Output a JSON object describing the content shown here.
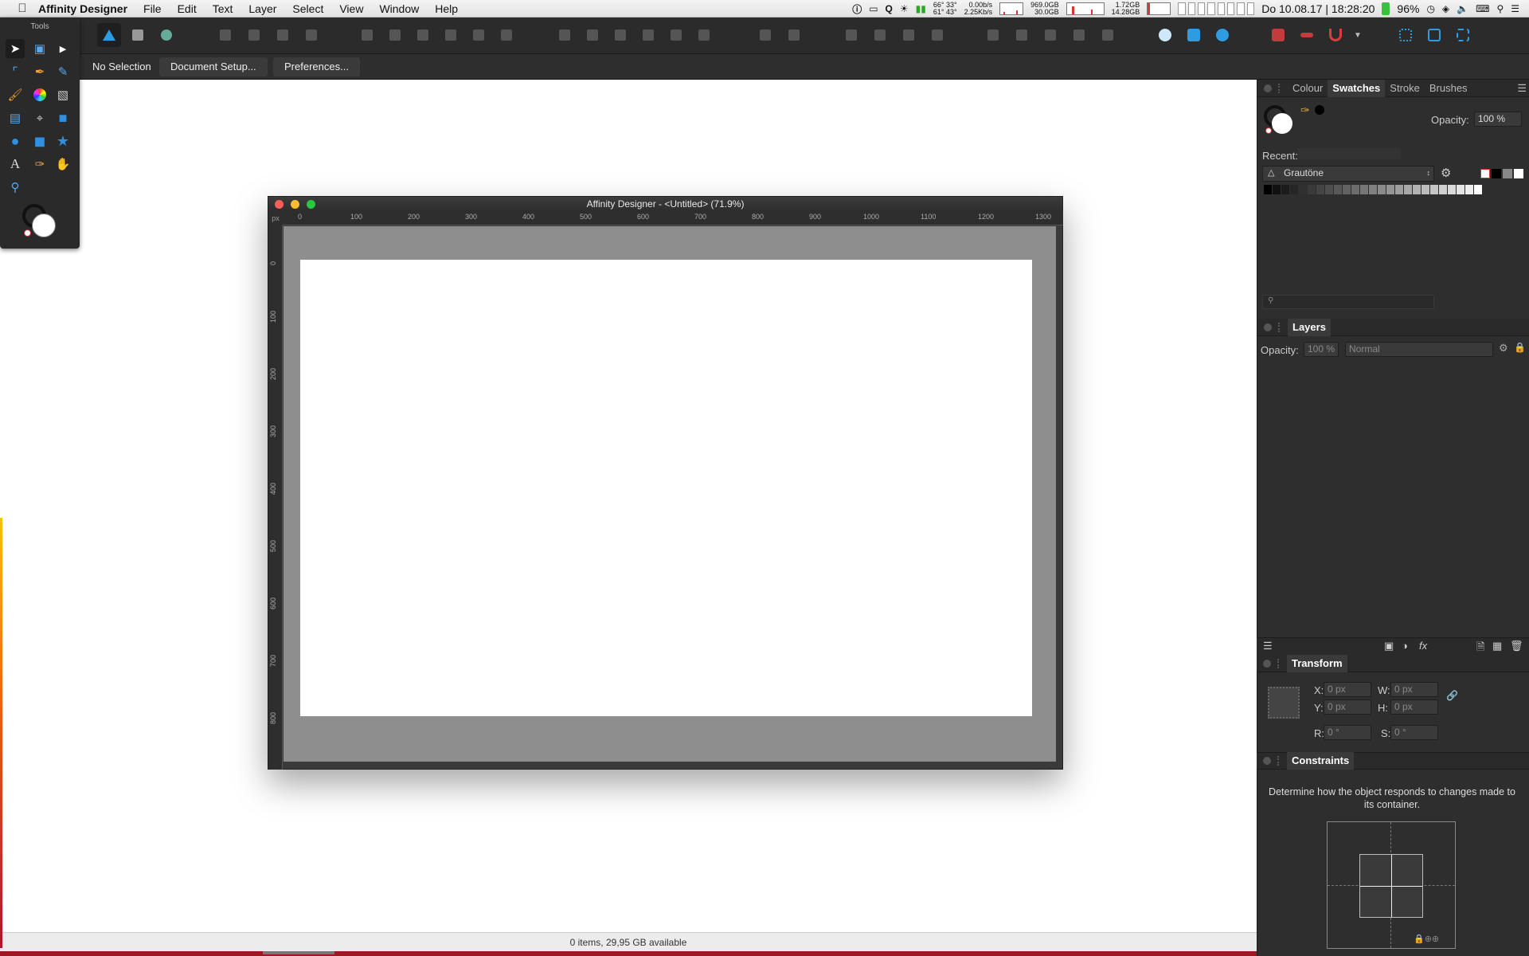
{
  "menubar": {
    "app_name": "Affinity Designer",
    "menus": [
      "File",
      "Edit",
      "Text",
      "Layer",
      "Select",
      "View",
      "Window",
      "Help"
    ],
    "status": {
      "temps": [
        "66°  33°",
        "61°  43°"
      ],
      "net": [
        "0.00b/s",
        "2.25Kb/s"
      ],
      "disk": [
        "969.0GB",
        "30.0GB"
      ],
      "mem": [
        "1.72GB",
        "14.28GB"
      ],
      "datetime": "Do 10.08.17 | 18:28:20",
      "battery": "96%"
    }
  },
  "context_toolbar": {
    "selection": "No Selection",
    "document_setup": "Document Setup...",
    "preferences": "Preferences..."
  },
  "tools_panel": {
    "title": "Tools"
  },
  "canvas_window": {
    "title": "Affinity Designer - <Untitled> (71.9%)",
    "ruler_unit": "px",
    "h_ticks": [
      "0",
      "100",
      "200",
      "300",
      "400",
      "500",
      "600",
      "700",
      "800",
      "900",
      "1000",
      "1100",
      "1200",
      "1300"
    ],
    "v_ticks": [
      "0",
      "100",
      "200",
      "300",
      "400",
      "500",
      "600",
      "700",
      "800"
    ]
  },
  "swatches_panel": {
    "tabs": [
      "Colour",
      "Swatches",
      "Stroke",
      "Brushes"
    ],
    "active_tab": "Swatches",
    "opacity_label": "Opacity:",
    "opacity_value": "100 %",
    "recent_label": "Recent:",
    "palette_name": "Grautöne",
    "grays": [
      "#000000",
      "#111111",
      "#1c1c1c",
      "#262626",
      "#303030",
      "#3a3a3a",
      "#444444",
      "#4e4e4e",
      "#585858",
      "#626262",
      "#6c6c6c",
      "#767676",
      "#808080",
      "#8a8a8a",
      "#949494",
      "#9e9e9e",
      "#a8a8a8",
      "#b2b2b2",
      "#bcbcbc",
      "#c6c6c6",
      "#d0d0d0",
      "#dadada",
      "#e4e4e4",
      "#eeeeee",
      "#ffffff"
    ]
  },
  "layers_panel": {
    "title": "Layers",
    "opacity_label": "Opacity:",
    "opacity_value": "100 %",
    "blend_mode": "Normal"
  },
  "transform_panel": {
    "title": "Transform",
    "x_label": "X:",
    "x_value": "0 px",
    "y_label": "Y:",
    "y_value": "0 px",
    "w_label": "W:",
    "w_value": "0 px",
    "h_label": "H:",
    "h_value": "0 px",
    "r_label": "R:",
    "r_value": "0 °",
    "s_label": "S:",
    "s_value": "0 °"
  },
  "constraints_panel": {
    "title": "Constraints",
    "description": "Determine how the object responds to changes made to its container."
  },
  "statusbar": {
    "text": "0 items, 29,95 GB available"
  },
  "colors": {
    "accent": "#2f9be0",
    "panel_bg": "#2e2e2e",
    "pasteboard": "#8e8e8e",
    "close": "#fc5f57",
    "minimize": "#fdbc2e",
    "zoom": "#28c840"
  }
}
